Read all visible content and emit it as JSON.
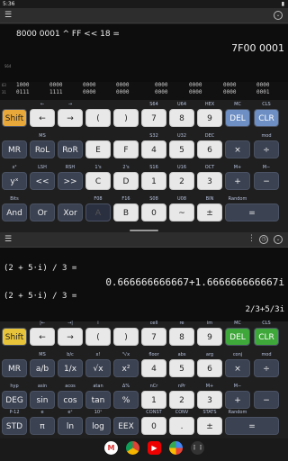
{
  "status": {
    "time": "5:36",
    "battery": "▮"
  },
  "top": {
    "expression": "8000 0001 ^ FF << 18 =",
    "result": "7F00 0001",
    "reg_label": "S64",
    "bits": {
      "row1_label": "63",
      "row2_label": "31",
      "row1": [
        "1000",
        "0000",
        "0000",
        "0000",
        "0000",
        "0000",
        "0000",
        "0000"
      ],
      "row2": [
        "0111",
        "1111",
        "0000",
        "0000",
        "0000",
        "0000",
        "0000",
        "0001"
      ]
    },
    "row0_labels": [
      "←",
      "→",
      "",
      "",
      "S64",
      "U64",
      "HEX",
      "MC",
      "CLS"
    ],
    "row0": [
      "Shift",
      "←",
      "→",
      "(",
      ")",
      "7",
      "8",
      "9",
      "DEL",
      "CLR"
    ],
    "row1_labels": [
      "MS",
      "",
      "",
      "",
      "S32",
      "U32",
      "DEC",
      "",
      "mod"
    ],
    "row1": [
      "MR",
      "RoL",
      "RoR",
      "E",
      "F",
      "4",
      "5",
      "6",
      "×",
      "÷"
    ],
    "row2_labels": [
      "x²",
      "LSH",
      "RSH",
      "1's",
      "2's",
      "S16",
      "U16",
      "OCT",
      "M+",
      "M−"
    ],
    "row2": [
      "yˣ",
      "<<",
      ">>",
      "C",
      "D",
      "1",
      "2",
      "3",
      "+",
      "−"
    ],
    "row3_labels": [
      "Bits",
      "",
      "",
      "F08",
      "F16",
      "S08",
      "U08",
      "BIN",
      "Random"
    ],
    "row3": [
      "And",
      "Or",
      "Xor",
      "A",
      "B",
      "0",
      "~",
      "±",
      "="
    ]
  },
  "bottom": {
    "expr1": "(2 + 5·i) / 3 =",
    "result1": "0.666666666667+1.666666666667i",
    "expr2": "(2 + 5·i) / 3 =",
    "result2": "2/3+5/3i",
    "row0_labels": [
      "|←",
      "→|",
      "i",
      "",
      "cell",
      "re",
      "im",
      "MC",
      "CLS"
    ],
    "row0": [
      "Shift",
      "←",
      "→",
      "(",
      ")",
      "7",
      "8",
      "9",
      "DEL",
      "CLR"
    ],
    "row1_labels": [
      "MS",
      "b/c",
      "x!",
      "³√x",
      "floor",
      "abs",
      "arg",
      "conj",
      "mod"
    ],
    "row1": [
      "MR",
      "a/b",
      "1/x",
      "√x",
      "x²",
      "4",
      "5",
      "6",
      "×",
      "÷"
    ],
    "row2_labels": [
      "hyp",
      "asin",
      "acos",
      "atan",
      "Δ%",
      "nCr",
      "nPr",
      "M+",
      "M−"
    ],
    "row2": [
      "DEG",
      "sin",
      "cos",
      "tan",
      "%",
      "1",
      "2",
      "3",
      "+",
      "−"
    ],
    "row3_labels": [
      "P-12",
      "e",
      "eˣ",
      "10ˣ",
      "",
      "CONST",
      "CONV",
      "STATS",
      "Random"
    ],
    "row3": [
      "STD",
      "π",
      "ln",
      "log",
      "EEX",
      "0",
      ".",
      "±",
      "="
    ]
  },
  "icons": [
    "gmail-icon",
    "chrome-icon",
    "youtube-icon",
    "photos-icon",
    "apps-icon"
  ]
}
